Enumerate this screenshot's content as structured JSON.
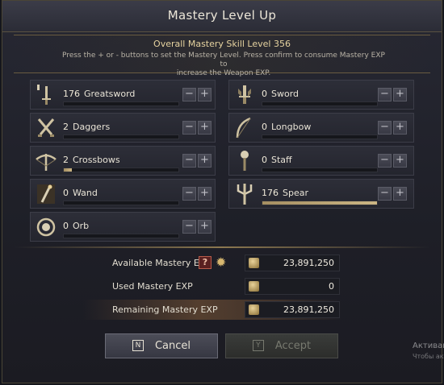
{
  "window": {
    "title": "Mastery Level Up"
  },
  "header": {
    "overall": "Overall Mastery Skill Level 356",
    "instruction_line1": "Press the + or - buttons to set the Mastery Level. Press confirm to consume Mastery EXP to",
    "instruction_line2": "increase the Weapon EXP."
  },
  "weapons": [
    {
      "level": "176",
      "name": "Greatsword",
      "progress": 0.0,
      "icon": "greatsword-icon"
    },
    {
      "level": "0",
      "name": "Sword",
      "progress": 0.0,
      "icon": "sword-icon"
    },
    {
      "level": "2",
      "name": "Daggers",
      "progress": 0.0,
      "icon": "daggers-icon"
    },
    {
      "level": "0",
      "name": "Longbow",
      "progress": 0.0,
      "icon": "longbow-icon"
    },
    {
      "level": "2",
      "name": "Crossbows",
      "progress": 0.07,
      "icon": "crossbow-icon"
    },
    {
      "level": "0",
      "name": "Staff",
      "progress": 0.0,
      "icon": "staff-icon"
    },
    {
      "level": "0",
      "name": "Wand",
      "progress": 0.0,
      "icon": "wand-icon"
    },
    {
      "level": "176",
      "name": "Spear",
      "progress": 1.0,
      "icon": "spear-icon"
    },
    {
      "level": "0",
      "name": "Orb",
      "progress": 0.0,
      "icon": "orb-icon"
    }
  ],
  "controls": {
    "minus": "−",
    "plus": "+"
  },
  "exp": {
    "available_label": "Available Mastery EXP",
    "available_value": "23,891,250",
    "help": "?",
    "used_label": "Used Mastery EXP",
    "used_value": "0",
    "remaining_label": "Remaining Mastery EXP",
    "remaining_value": "23,891,250"
  },
  "buttons": {
    "cancel_key": "N",
    "cancel_label": "Cancel",
    "accept_key": "Y",
    "accept_label": "Accept"
  },
  "watermark": {
    "line1": "Активац",
    "line2": "Чтобы акт"
  }
}
